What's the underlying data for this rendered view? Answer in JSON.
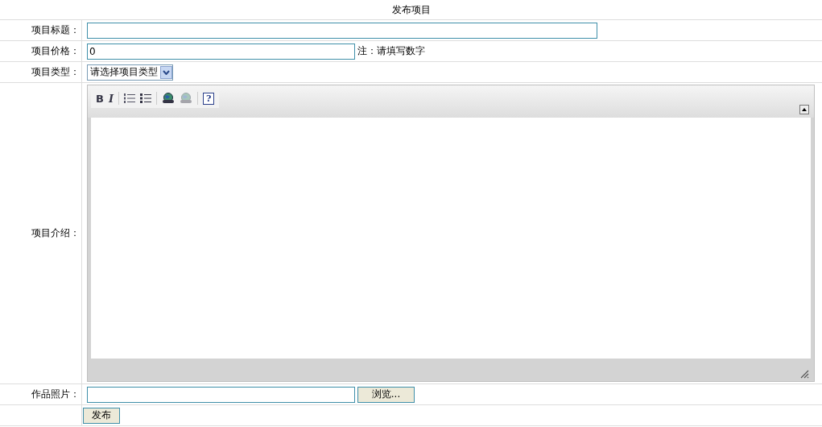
{
  "title": "发布项目",
  "fields": [
    {
      "kind": "text",
      "label": "项目标题："
    },
    {
      "kind": "price",
      "label": "项目价格：",
      "value": "0",
      "note": "注：请填写数字"
    },
    {
      "kind": "select",
      "label": "项目类型：",
      "value": "请选择项目类型"
    },
    {
      "kind": "editor",
      "label": "项目介绍：",
      "toolbar": [
        {
          "kind": "bold",
          "glyph": "B",
          "disabled": false
        },
        {
          "kind": "italic",
          "glyph": "I",
          "disabled": false
        },
        {
          "kind": "separator"
        },
        {
          "kind": "ordered-list",
          "disabled": false
        },
        {
          "kind": "bullet-list",
          "disabled": false
        },
        {
          "kind": "separator"
        },
        {
          "kind": "globe",
          "disabled": false
        },
        {
          "kind": "globe",
          "disabled": true
        },
        {
          "kind": "separator"
        },
        {
          "kind": "help",
          "glyph": "?",
          "disabled": false
        }
      ]
    },
    {
      "kind": "file",
      "label": "作品照片：",
      "button": "浏览..."
    }
  ],
  "submit": "发布"
}
